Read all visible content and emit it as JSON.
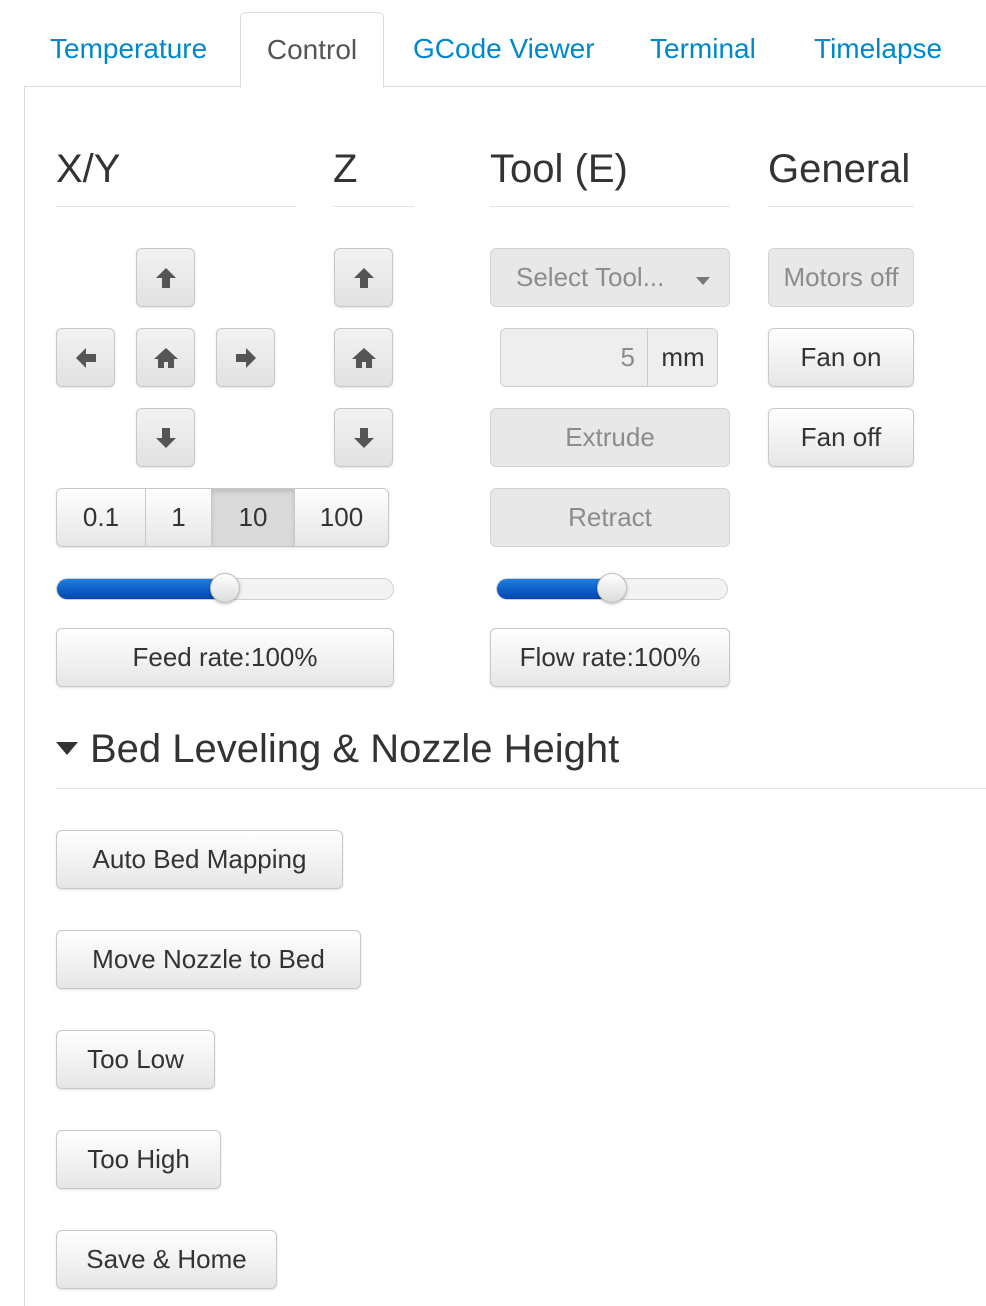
{
  "tabs": [
    {
      "label": "Temperature",
      "active": false
    },
    {
      "label": "Control",
      "active": true
    },
    {
      "label": "GCode Viewer",
      "active": false
    },
    {
      "label": "Terminal",
      "active": false
    },
    {
      "label": "Timelapse",
      "active": false
    }
  ],
  "sections": {
    "xy": "X/Y",
    "z": "Z",
    "tool": "Tool (E)",
    "general": "General"
  },
  "icons": {
    "up": "arrow-up-icon",
    "down": "arrow-down-icon",
    "left": "arrow-left-icon",
    "right": "arrow-right-icon",
    "home": "home-icon",
    "caret": "caret-down-icon"
  },
  "jog_distances": {
    "options": [
      "0.1",
      "1",
      "10",
      "100"
    ],
    "selected": "10"
  },
  "feed_rate": {
    "label": "Feed rate:100%",
    "slider_fraction": 0.5
  },
  "tool": {
    "select_label": "Select Tool...",
    "extrude_amount": "5",
    "unit": "mm",
    "extrude_label": "Extrude",
    "retract_label": "Retract"
  },
  "flow_rate": {
    "label": "Flow rate:100%",
    "slider_fraction": 0.5
  },
  "general": {
    "motors_off": "Motors off",
    "fan_on": "Fan on",
    "fan_off": "Fan off"
  },
  "bed_leveling": {
    "title": "Bed Leveling & Nozzle Height",
    "buttons": [
      "Auto Bed Mapping",
      "Move Nozzle to Bed",
      "Too Low",
      "Too High",
      "Save & Home"
    ]
  },
  "colors": {
    "link": "#0088cc",
    "slider_fill": "#0055c4"
  }
}
